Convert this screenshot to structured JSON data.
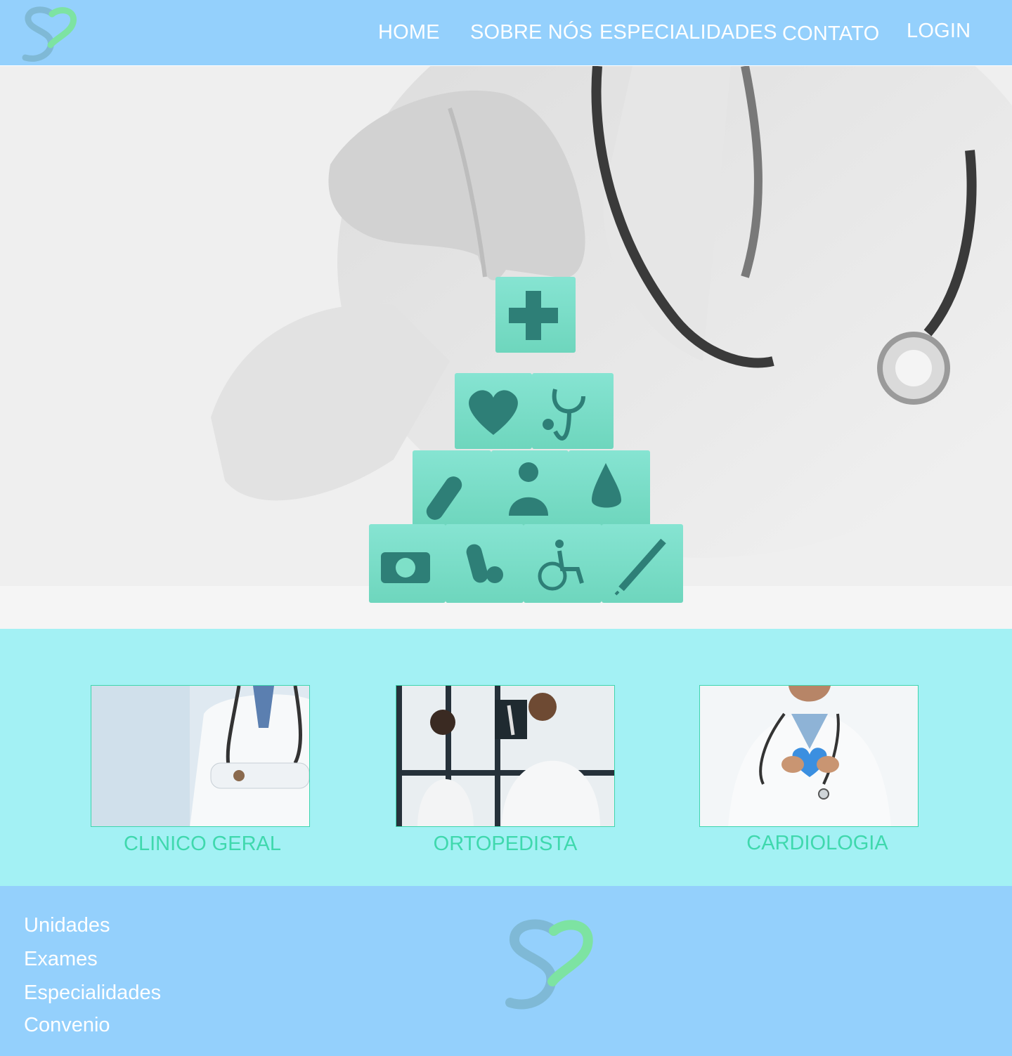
{
  "colors": {
    "header_bg": "#94d0fc",
    "band_bg": "#a3f1f4",
    "accent_green": "#3fd8ad",
    "block_teal": "#7ee0c8",
    "icon_teal": "#2e7f77"
  },
  "header": {
    "logo_icon": "heart-s-logo",
    "nav": {
      "home": "HOME",
      "sobre": "SOBRE NÓS",
      "especialidades": "ESPECIALIDADES",
      "contato": "CONTATO",
      "login": "LOGIN"
    }
  },
  "hero": {
    "image": "doctor-stacking-medical-blocks",
    "block_icons": [
      "plus-icon",
      "heart-pulse-icon",
      "stethoscope-icon",
      "bandage-icon",
      "doctor-icon",
      "drop-icon",
      "medkit-icon",
      "pills-icon",
      "wheelchair-icon",
      "syringe-icon"
    ]
  },
  "specialties": [
    {
      "label": "CLINICO GERAL",
      "image": "doctor-arms-crossed"
    },
    {
      "label": "ORTOPEDISTA",
      "image": "doctors-reviewing-xray"
    },
    {
      "label": "CARDIOLOGIA",
      "image": "doctor-holding-heart"
    }
  ],
  "footer": {
    "links": [
      "Unidades",
      "Exames",
      "Especialidades",
      "Convenio"
    ],
    "logo_icon": "heart-s-logo"
  }
}
